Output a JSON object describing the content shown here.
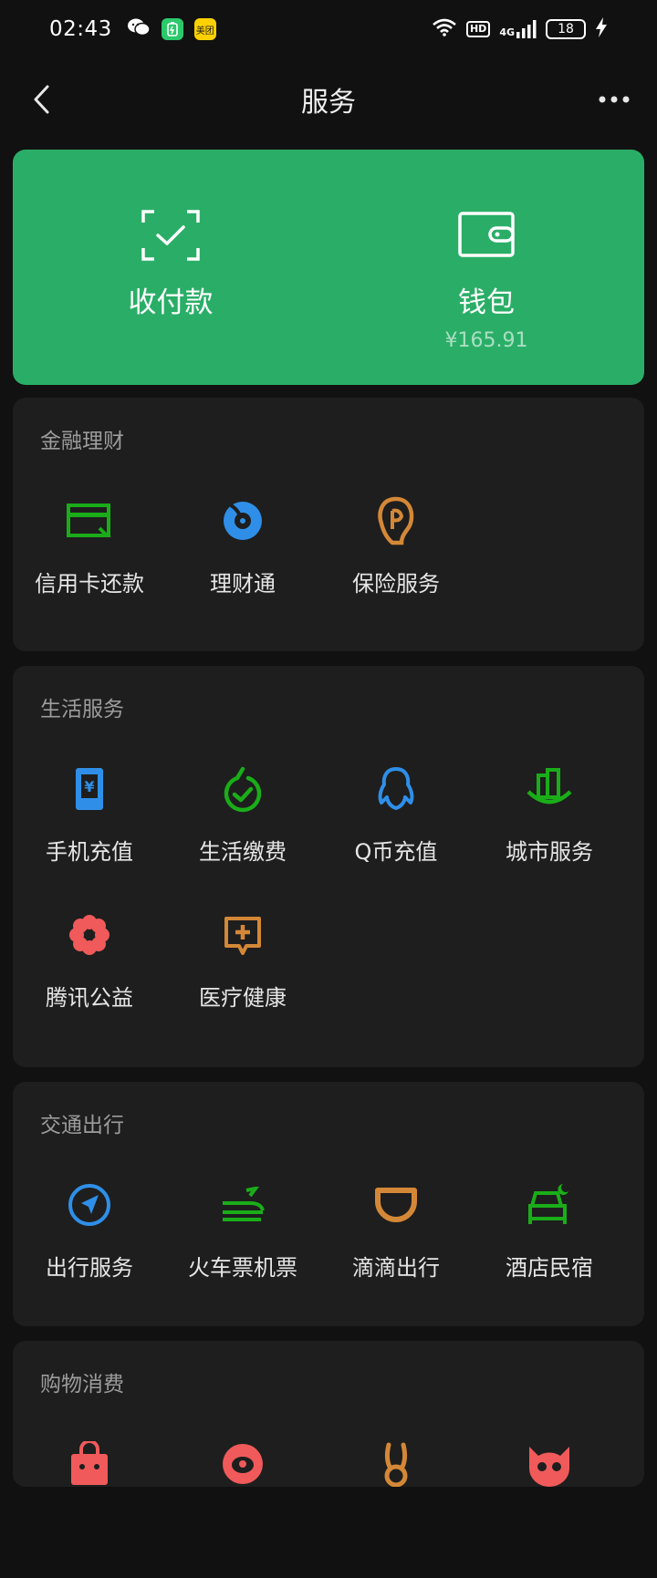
{
  "status": {
    "time": "02:43",
    "apps": [
      "wechat-icon",
      "battery-saver-app-icon",
      "meituan-icon"
    ],
    "meituan_text": "美团",
    "hd": "HD",
    "network": "4G",
    "battery": "18"
  },
  "nav": {
    "title": "服务"
  },
  "hero": {
    "pay": {
      "label": "收付款"
    },
    "wallet": {
      "label": "钱包",
      "balance": "¥165.91"
    }
  },
  "sections": [
    {
      "title": "金融理财",
      "items": [
        {
          "label": "信用卡还款",
          "icon": "credit-card-icon"
        },
        {
          "label": "理财通",
          "icon": "wealth-icon"
        },
        {
          "label": "保险服务",
          "icon": "insurance-icon"
        }
      ]
    },
    {
      "title": "生活服务",
      "items": [
        {
          "label": "手机充值",
          "icon": "phone-recharge-icon"
        },
        {
          "label": "生活缴费",
          "icon": "utility-payment-icon"
        },
        {
          "label": "Q币充值",
          "icon": "qq-coin-icon"
        },
        {
          "label": "城市服务",
          "icon": "city-service-icon"
        },
        {
          "label": "腾讯公益",
          "icon": "charity-icon"
        },
        {
          "label": "医疗健康",
          "icon": "medical-icon"
        }
      ]
    },
    {
      "title": "交通出行",
      "items": [
        {
          "label": "出行服务",
          "icon": "travel-service-icon"
        },
        {
          "label": "火车票机票",
          "icon": "train-plane-icon"
        },
        {
          "label": "滴滴出行",
          "icon": "didi-icon"
        },
        {
          "label": "酒店民宿",
          "icon": "hotel-icon"
        }
      ]
    },
    {
      "title": "购物消费",
      "items": [
        {
          "label": "",
          "icon": "shopping-bag-icon"
        },
        {
          "label": "",
          "icon": "pinduoduo-icon"
        },
        {
          "label": "",
          "icon": "meituan-rabbit-icon"
        },
        {
          "label": "",
          "icon": "cat-icon"
        }
      ]
    }
  ],
  "colors": {
    "accent_green": "#2aae67",
    "card_bg": "#1e1e1e",
    "page_bg": "#111111",
    "icon_green": "#1aad19",
    "icon_blue": "#2f8fe8",
    "icon_orange": "#d48837",
    "icon_red": "#f05a5a"
  }
}
